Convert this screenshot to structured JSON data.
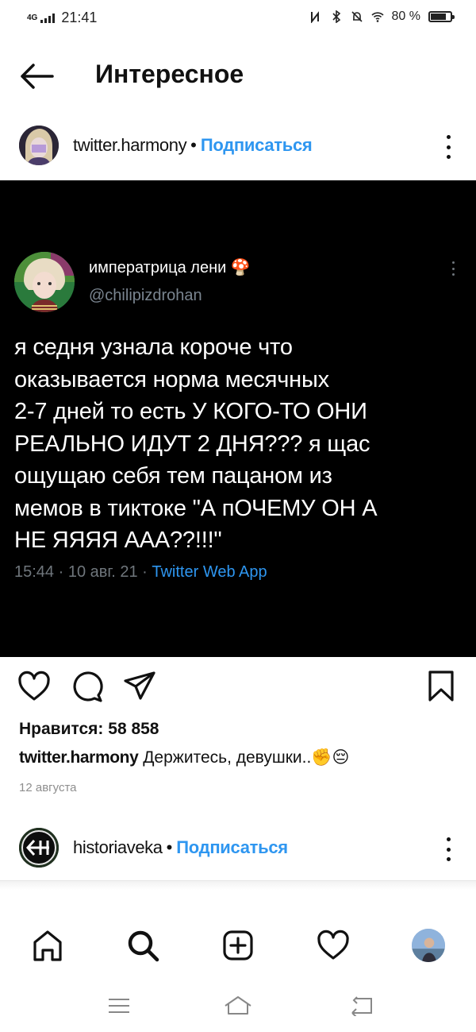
{
  "status_bar": {
    "network": "4G",
    "time": "21:41",
    "battery": "80 %",
    "battery_level": 0.8
  },
  "header": {
    "title": "Интересное",
    "back_icon": "arrow-left-icon"
  },
  "post": {
    "username": "twitter.harmony",
    "separator": "•",
    "follow_label": "Подписаться",
    "tweet": {
      "author_name": "императрица лени 🍄",
      "handle": "@chilipizdrohan",
      "text": "я седня узнала короче что\nоказывается норма месячных\n2-7 дней то есть У КОГО-ТО ОНИ\nРЕАЛЬНО ИДУТ 2 ДНЯ??? я щас\nощущаю себя тем пацаном из\nмемов в тиктоке \"А пОЧЕМУ ОН А\nНЕ ЯЯЯЯ ААА??!!!\"",
      "meta_time": "15:44 · 10 авг. 21 · ",
      "meta_source": "Twitter Web App"
    },
    "likes": "Нравится: 58 858",
    "caption_user": "twitter.harmony",
    "caption_text": " Держитесь, девушки..✊😔",
    "date": "12 августа"
  },
  "next_post": {
    "username": "historiaveka",
    "separator": "•",
    "follow_label": "Подписаться"
  },
  "bottom_nav": [
    "home-icon",
    "search-icon",
    "new-post-icon",
    "activity-heart-icon",
    "profile-avatar"
  ],
  "colors": {
    "accent": "#2e96f0",
    "tweet_bg": "#000000",
    "muted": "#8e8e8e"
  }
}
